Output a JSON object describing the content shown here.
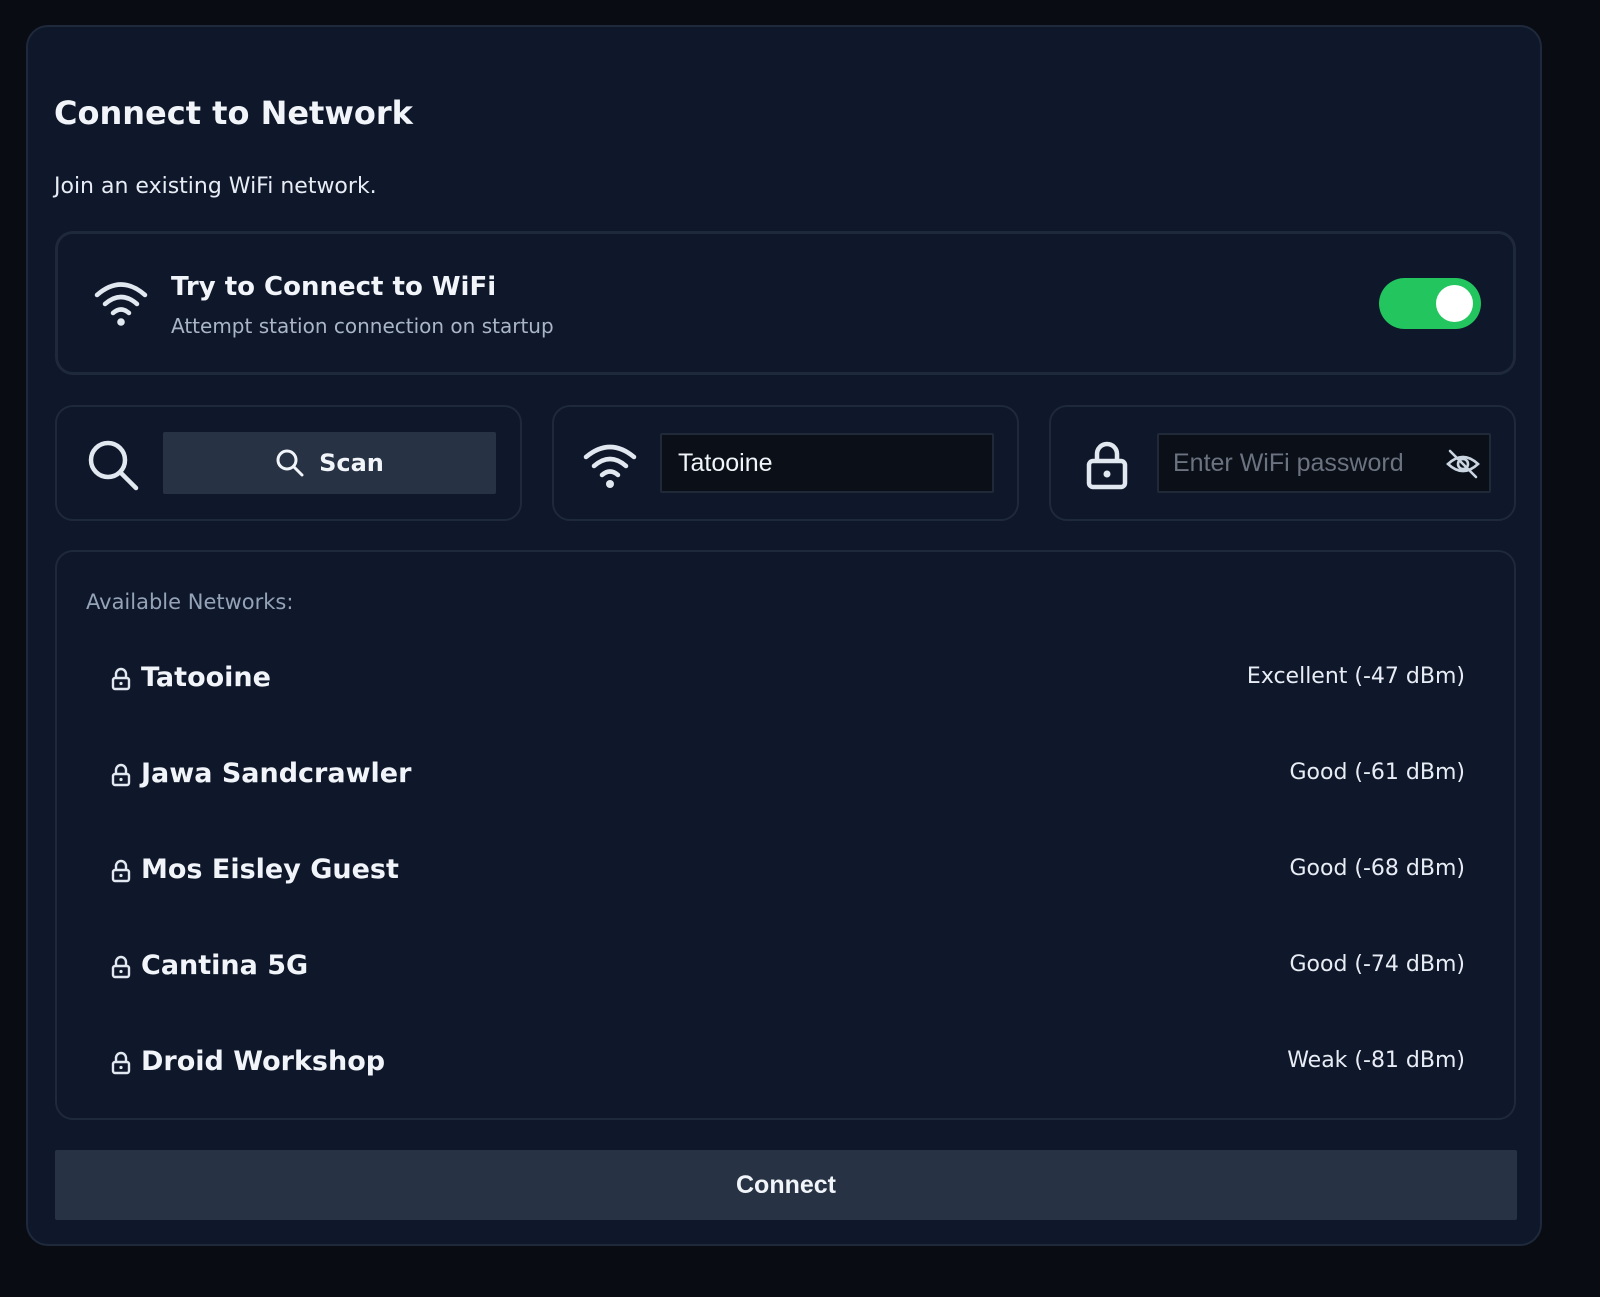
{
  "page": {
    "title": "Connect to Network",
    "subtitle": "Join an existing WiFi network."
  },
  "station_toggle": {
    "icon": "wifi-icon",
    "title": "Try to Connect to WiFi",
    "description": "Attempt station connection on startup",
    "enabled": true,
    "on_color": "#22c55e"
  },
  "controls": {
    "scan_icon": "search-icon",
    "scan_label": "Scan",
    "ssid_icon": "wifi-icon",
    "ssid_value": "Tatooine",
    "password_icon": "lock-icon",
    "password_value": "",
    "password_placeholder": "Enter WiFi password",
    "visibility_icon": "eye-off-icon"
  },
  "networks": {
    "heading": "Available Networks:",
    "items": [
      {
        "name": "Tatooine",
        "signal": "Excellent (-47 dBm)",
        "icon": "lock-icon"
      },
      {
        "name": "Jawa Sandcrawler",
        "signal": "Good (-61 dBm)",
        "icon": "lock-icon"
      },
      {
        "name": "Mos Eisley Guest",
        "signal": "Good (-68 dBm)",
        "icon": "lock-icon"
      },
      {
        "name": "Cantina 5G",
        "signal": "Good (-74 dBm)",
        "icon": "lock-icon"
      },
      {
        "name": "Droid Workshop",
        "signal": "Weak (-81 dBm)",
        "icon": "lock-icon"
      }
    ]
  },
  "footer": {
    "connect_label": "Connect"
  },
  "colors": {
    "background": "#090d13",
    "panel": "#0f172a",
    "border": "#1e293b",
    "button": "#273244",
    "accent_green": "#22c55e",
    "muted_text": "#94a3b8"
  }
}
